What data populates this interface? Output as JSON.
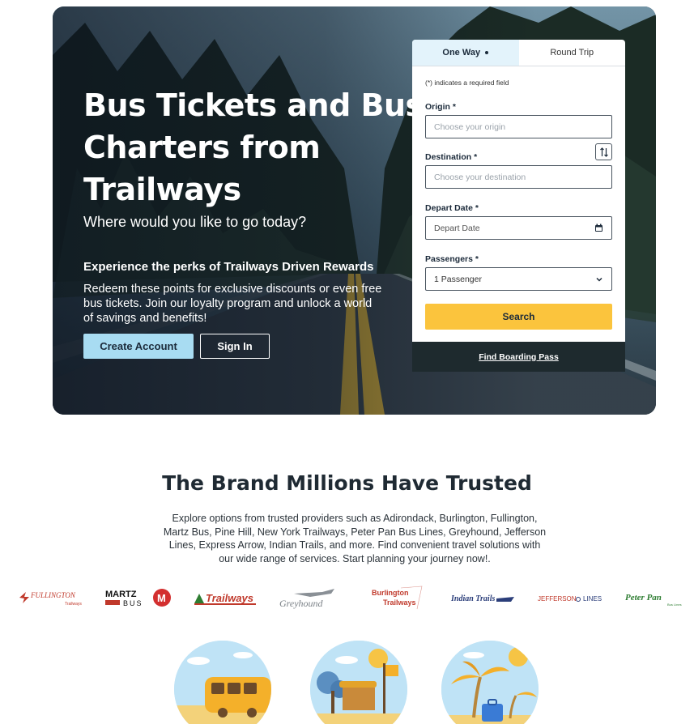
{
  "hero": {
    "title": "Bus Tickets and Bus Charters from Trailways",
    "subtitle": "Where would you like to go today?",
    "perks_title": "Experience the perks of Trailways Driven Rewards",
    "perks_text": "Redeem these points for exclusive discounts or even free bus tickets. Join our loyalty program and unlock a world of savings and benefits!",
    "create_account_label": "Create Account",
    "sign_in_label": "Sign In"
  },
  "booking": {
    "tabs": [
      {
        "label": "One Way",
        "active": true
      },
      {
        "label": "Round Trip",
        "active": false
      }
    ],
    "required_note": "(*) indicates a required field",
    "origin_label": "Origin *",
    "origin_placeholder": "Choose your origin",
    "destination_label": "Destination *",
    "destination_placeholder": "Choose your destination",
    "depart_label": "Depart Date *",
    "depart_placeholder": "Depart Date",
    "passengers_label": "Passengers *",
    "passengers_value": "1 Passenger",
    "search_label": "Search",
    "boarding_pass_label": "Find Boarding Pass"
  },
  "brands": {
    "title": "The Brand Millions Have Trusted",
    "text": "Explore options from trusted providers such as Adirondack, Burlington, Fullington, Martz Bus, Pine Hill, New York Trailways, Peter Pan Bus Lines, Greyhound, Jefferson Lines, Express Arrow, Indian Trails, and more. Find convenient travel solutions with our wide range of services. Start planning your journey now!.",
    "logos": [
      {
        "name": "FULLINGTON",
        "sub": "Trailways"
      },
      {
        "name": "MARTZ",
        "sub": "BUS"
      },
      {
        "name": "Trailways"
      },
      {
        "name": "Greyhound"
      },
      {
        "name": "Burlington",
        "sub": "Trailways"
      },
      {
        "name": "Indian Trails"
      },
      {
        "name": "JEFFERSON",
        "sub": "LINES"
      },
      {
        "name": "Peter Pan",
        "sub": "Bus Lines"
      }
    ]
  },
  "colors": {
    "accent_yellow": "#fbc43d",
    "accent_blue": "#a8dcf2",
    "dark": "#1e2a2e"
  }
}
